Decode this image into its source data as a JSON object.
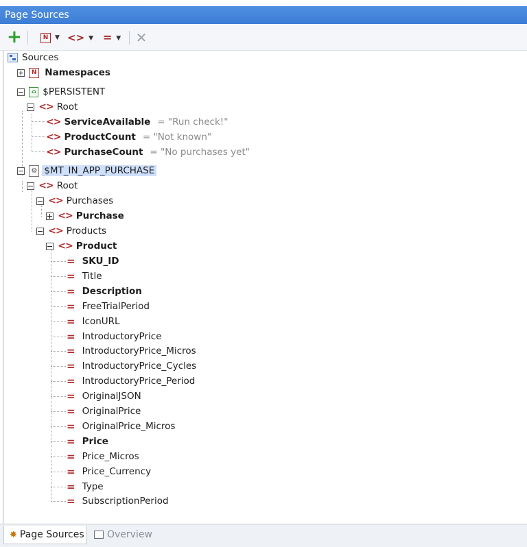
{
  "window": {
    "title": "Page Sources"
  },
  "toolbar": {
    "add_icon": "plus-icon",
    "namespace_glyph": "N",
    "element_glyph": "<>",
    "attribute_glyph": "=",
    "dropdown_glyph": "▼",
    "delete_glyph": "✕"
  },
  "tree": {
    "root_label": "Sources",
    "namespaces_label": "Namespaces",
    "persistent": {
      "label": "$PERSISTENT",
      "root_label": "Root",
      "attributes": [
        {
          "name": "ServiceAvailable",
          "value": "= \"Run check!\""
        },
        {
          "name": "ProductCount",
          "value": "= \"Not known\""
        },
        {
          "name": "PurchaseCount",
          "value": "= \"No purchases yet\""
        }
      ]
    },
    "mt": {
      "label": "$MT_IN_APP_PURCHASE",
      "root_label": "Root",
      "purchases_label": "Purchases",
      "purchase_label": "Purchase",
      "products_label": "Products",
      "product_label": "Product",
      "product_fields": [
        {
          "name": "SKU_ID",
          "bold": true
        },
        {
          "name": "Title",
          "bold": false
        },
        {
          "name": "Description",
          "bold": true
        },
        {
          "name": "FreeTrialPeriod",
          "bold": false
        },
        {
          "name": "IconURL",
          "bold": false
        },
        {
          "name": "IntroductoryPrice",
          "bold": false
        },
        {
          "name": "IntroductoryPrice_Micros",
          "bold": false
        },
        {
          "name": "IntroductoryPrice_Cycles",
          "bold": false
        },
        {
          "name": "IntroductoryPrice_Period",
          "bold": false
        },
        {
          "name": "OriginalJSON",
          "bold": false
        },
        {
          "name": "OriginalPrice",
          "bold": false
        },
        {
          "name": "OriginalPrice_Micros",
          "bold": false
        },
        {
          "name": "Price",
          "bold": true
        },
        {
          "name": "Price_Micros",
          "bold": false
        },
        {
          "name": "Price_Currency",
          "bold": false
        },
        {
          "name": "Type",
          "bold": false
        },
        {
          "name": "SubscriptionPeriod",
          "bold": false
        }
      ]
    }
  },
  "bottom_tabs": [
    {
      "label": "Page Sources",
      "icon": "gear-sun-icon",
      "active": true
    },
    {
      "label": "Overview",
      "icon": "overview-icon",
      "active": false
    }
  ]
}
